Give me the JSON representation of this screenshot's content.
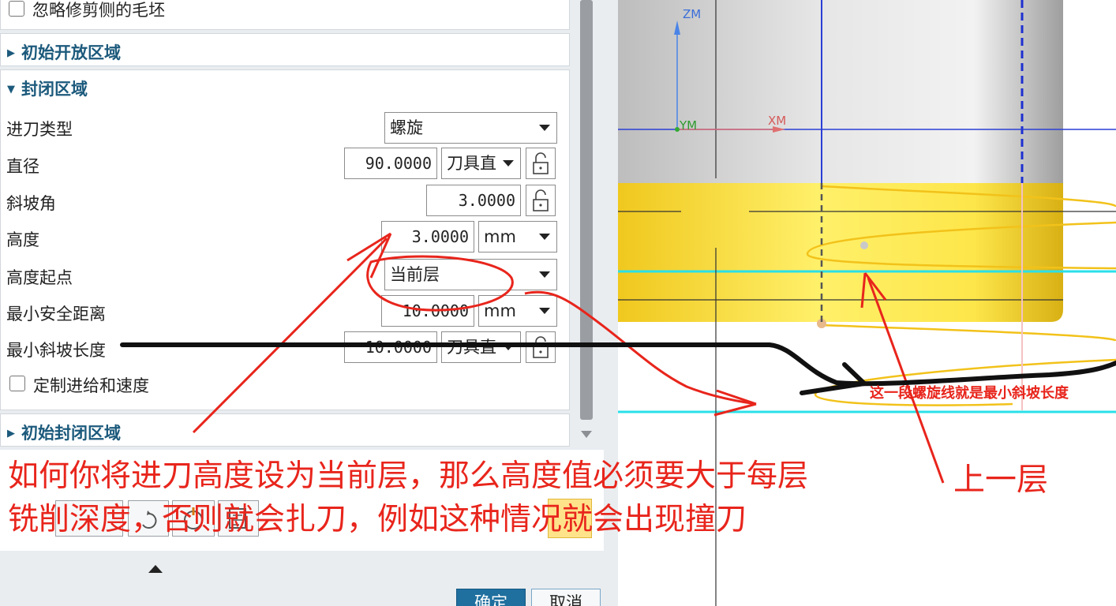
{
  "dialog": {
    "ignore_trimmed_blank": "忽略修剪侧的毛坯",
    "sections": {
      "initial_open_area": "初始开放区域",
      "closed_area": "封闭区域",
      "initial_closed_area": "初始封闭区域"
    },
    "fields": {
      "entry_type": {
        "label": "进刀类型",
        "value": "螺旋"
      },
      "diameter": {
        "label": "直径",
        "value": "90.0000",
        "unit": "刀具直"
      },
      "ramp_angle": {
        "label": "斜坡角",
        "value": "3.0000"
      },
      "height": {
        "label": "高度",
        "value": "3.0000",
        "unit": "mm"
      },
      "height_from": {
        "label": "高度起点",
        "value": "当前层"
      },
      "min_safe_distance": {
        "label": "最小安全距离",
        "value": "10.0000",
        "unit": "mm"
      },
      "min_ramp_length": {
        "label": "最小斜坡长度",
        "value": "10.0000",
        "unit": "刀具直"
      }
    },
    "custom_feed": "定制进给和速度",
    "buttons": {
      "ok": "确定",
      "cancel": "取消"
    }
  },
  "viewport": {
    "axes": {
      "z": "ZM",
      "y": "YM",
      "x": "XM"
    }
  },
  "annotations": {
    "main_note_line1": "如何你将进刀高度设为当前层，那么高度值必须要大于每层",
    "main_note_line2": "铣削深度，否则就会扎刀，例如这种情况就会出现撞刀",
    "prev_layer": "上一层",
    "helix_note": "这一段螺旋线就是最小斜坡长度"
  },
  "colors": {
    "section_title": "#1c5a7c",
    "annotation_red": "#e8251c",
    "ok_button": "#1f6f9f",
    "part_yellow": "#f5d12a",
    "layer_cyan": "#29e0e8",
    "axis_blue": "#2b3fd6"
  }
}
